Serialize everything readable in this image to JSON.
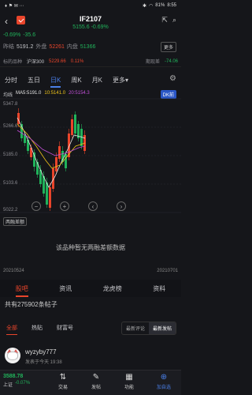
{
  "statusbar": {
    "carrier": "♦ ⚑ ✉ ⋯",
    "battery": "81%",
    "time": "8:55"
  },
  "header": {
    "title": "IF2107",
    "subtitle_price": "5155.6",
    "subtitle_change": "-0.69%"
  },
  "quote": {
    "change_pct": "-0.69%",
    "change_abs": "-35.6",
    "prev_close_label": "昨结",
    "prev_close": "5191.2",
    "outer_label": "外盘",
    "outer": "52261",
    "inner_label": "内盘",
    "inner": "51366",
    "more": "更多"
  },
  "indexbar": {
    "label": "标的品种",
    "index_name": "沪深300",
    "index_value": "5229.66",
    "index_change": "0.11%",
    "basis_label": "期现差",
    "basis_value": "-74.06"
  },
  "period_tabs": [
    {
      "label": "分时",
      "active": false
    },
    {
      "label": "五日",
      "active": false
    },
    {
      "label": "日K",
      "active": true
    },
    {
      "label": "周K",
      "active": false
    },
    {
      "label": "月K",
      "active": false
    },
    {
      "label": "更多▾",
      "active": false
    }
  ],
  "chart": {
    "ma_label": "均线",
    "ma5": "MA5:5191.0",
    "ma10": "10:5141.0",
    "ma20": "20:5154.3",
    "mode": "DK前",
    "y_labels": [
      "5347.8",
      "5266.6",
      "5185.0",
      "5103.6",
      "5022.2"
    ],
    "date_start": "20210524",
    "date_end": "20210701",
    "colors": {
      "up": "#e9452b",
      "down": "#21b35b",
      "ma5": "#e7e7e7",
      "ma10": "#f0c419",
      "ma20": "#c050d6"
    }
  },
  "margin": {
    "tag": "两融差额",
    "empty_text": "该品种暂无两融差额数据"
  },
  "news_tabs": [
    {
      "label": "股吧",
      "active": true
    },
    {
      "label": "资讯",
      "active": false
    },
    {
      "label": "龙虎榜",
      "active": false
    },
    {
      "label": "资料",
      "active": false
    }
  ],
  "post_count": "共有275902条帖子",
  "sub_tabs": [
    {
      "label": "全部",
      "active": true
    },
    {
      "label": "热贴",
      "active": false
    },
    {
      "label": "财富号",
      "active": false
    }
  ],
  "sort_options": [
    {
      "label": "最新评论",
      "active": false
    },
    {
      "label": "最新发帖",
      "active": true
    }
  ],
  "post": {
    "user": "wyzyby777",
    "time": "发表于今天 19:38"
  },
  "bottombar": {
    "index_value": "3588.78",
    "index_label": "上证",
    "index_change": "-0.07%",
    "items": [
      {
        "icon": "⇅",
        "label": "交易"
      },
      {
        "icon": "✎",
        "label": "发帖"
      },
      {
        "icon": "▦",
        "label": "功能"
      },
      {
        "icon": "⊕",
        "label": "加自选"
      }
    ]
  }
}
